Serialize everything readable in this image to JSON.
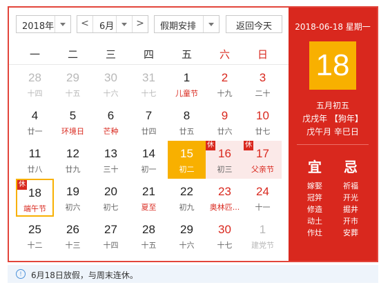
{
  "controls": {
    "year_select": "2018年",
    "prev_label": "<",
    "month_select": "6月",
    "next_label": ">",
    "holiday_select": "假期安排",
    "back_today": "返回今天"
  },
  "weekdays": [
    "一",
    "二",
    "三",
    "四",
    "五",
    "六",
    "日"
  ],
  "badge_text": "休",
  "days": [
    {
      "n": "28",
      "l": "十四",
      "other": true
    },
    {
      "n": "29",
      "l": "十五",
      "other": true
    },
    {
      "n": "30",
      "l": "十六",
      "other": true
    },
    {
      "n": "31",
      "l": "十七",
      "other": true
    },
    {
      "n": "1",
      "l": "儿童节",
      "fest": true
    },
    {
      "n": "2",
      "l": "十九",
      "we": true
    },
    {
      "n": "3",
      "l": "二十",
      "we": true
    },
    {
      "n": "4",
      "l": "廿一"
    },
    {
      "n": "5",
      "l": "环境日",
      "fest": true
    },
    {
      "n": "6",
      "l": "芒种",
      "fest": true
    },
    {
      "n": "7",
      "l": "廿四"
    },
    {
      "n": "8",
      "l": "廿五"
    },
    {
      "n": "9",
      "l": "廿六",
      "we": true
    },
    {
      "n": "10",
      "l": "廿七",
      "we": true
    },
    {
      "n": "11",
      "l": "廿八"
    },
    {
      "n": "12",
      "l": "廿九"
    },
    {
      "n": "13",
      "l": "三十"
    },
    {
      "n": "14",
      "l": "初一"
    },
    {
      "n": "15",
      "l": "初二",
      "today": true
    },
    {
      "n": "16",
      "l": "初三",
      "we": true,
      "holiday": true,
      "badge": true
    },
    {
      "n": "17",
      "l": "父亲节",
      "we": true,
      "holiday": true,
      "badge": true,
      "fest": true
    },
    {
      "n": "18",
      "l": "端午节",
      "sel": true,
      "badge": true,
      "fest": true
    },
    {
      "n": "19",
      "l": "初六"
    },
    {
      "n": "20",
      "l": "初七"
    },
    {
      "n": "21",
      "l": "夏至",
      "fest": true
    },
    {
      "n": "22",
      "l": "初九"
    },
    {
      "n": "23",
      "l": "奥林匹...",
      "we": true,
      "fest": true
    },
    {
      "n": "24",
      "l": "十一",
      "we": true
    },
    {
      "n": "25",
      "l": "十二"
    },
    {
      "n": "26",
      "l": "十三"
    },
    {
      "n": "27",
      "l": "十四"
    },
    {
      "n": "28",
      "l": "十五"
    },
    {
      "n": "29",
      "l": "十六"
    },
    {
      "n": "30",
      "l": "十七",
      "we": true
    },
    {
      "n": "1",
      "l": "建党节",
      "other": true
    }
  ],
  "panel": {
    "date_line": "2018-06-18 星期一",
    "big_day": "18",
    "lunar_date": "五月初五",
    "ganzhi_year": "戊戌年 【狗年】",
    "ganzhi_month_day": "戊午月 辛巳日",
    "yi_title": "宜",
    "ji_title": "忌",
    "yi_items": [
      "嫁娶",
      "冠笄",
      "修造",
      "动土",
      "作灶"
    ],
    "ji_items": [
      "祈福",
      "开光",
      "掘井",
      "开市",
      "安葬"
    ]
  },
  "notice": {
    "icon": "info-icon",
    "text": "6月18日放假，与周末连休。"
  },
  "colors": {
    "accent_red": "#d9281e",
    "today_gold": "#f8b000",
    "holiday_pink": "#fbe9e8",
    "notice_bg": "#eef4fb"
  }
}
